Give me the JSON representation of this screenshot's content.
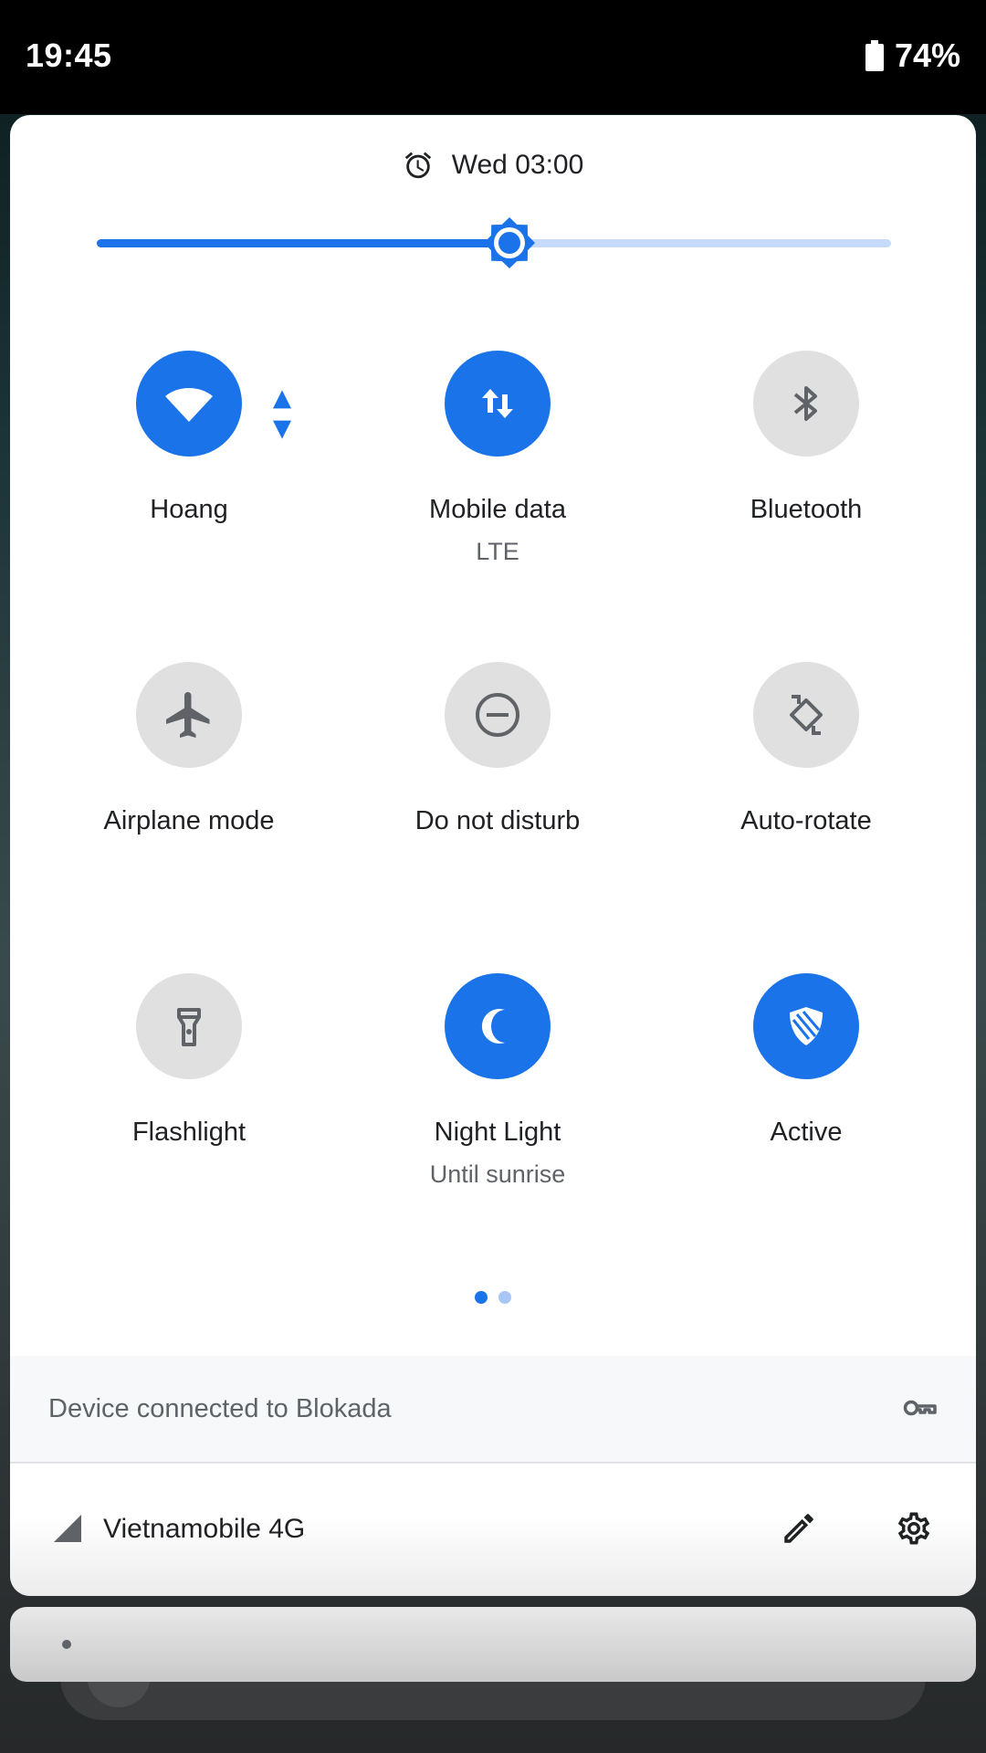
{
  "status_bar": {
    "time": "19:45",
    "battery": "74%"
  },
  "alarm": {
    "text": "Wed 03:00"
  },
  "brightness": {
    "level": 0.52
  },
  "tiles": [
    {
      "label": "Hoang",
      "sub": "",
      "state": "on",
      "icon": "wifi-icon"
    },
    {
      "label": "Mobile data",
      "sub": "LTE",
      "state": "on",
      "icon": "mobile-data-icon"
    },
    {
      "label": "Bluetooth",
      "sub": "",
      "state": "off",
      "icon": "bluetooth-icon"
    },
    {
      "label": "Airplane mode",
      "sub": "",
      "state": "off",
      "icon": "airplane-icon"
    },
    {
      "label": "Do not disturb",
      "sub": "",
      "state": "off",
      "icon": "do-not-disturb-icon"
    },
    {
      "label": "Auto-rotate",
      "sub": "",
      "state": "off",
      "icon": "auto-rotate-icon"
    },
    {
      "label": "Flashlight",
      "sub": "",
      "state": "off",
      "icon": "flashlight-icon"
    },
    {
      "label": "Night Light",
      "sub": "Until sunrise",
      "state": "on",
      "icon": "moon-icon"
    },
    {
      "label": "Active",
      "sub": "",
      "state": "on",
      "icon": "shield-icon"
    }
  ],
  "pager": {
    "pages": 2,
    "current": 1
  },
  "vpn": {
    "text": "Device connected to Blokada",
    "icon": "key-icon"
  },
  "footer": {
    "carrier": "Vietnamobile 4G",
    "edit_icon": "pencil-icon",
    "settings_icon": "gear-icon"
  },
  "colors": {
    "accent": "#1a73e8",
    "accent_light": "#c6dafb",
    "tile_off": "#e0e0e0",
    "icon_off": "#5f6368"
  }
}
